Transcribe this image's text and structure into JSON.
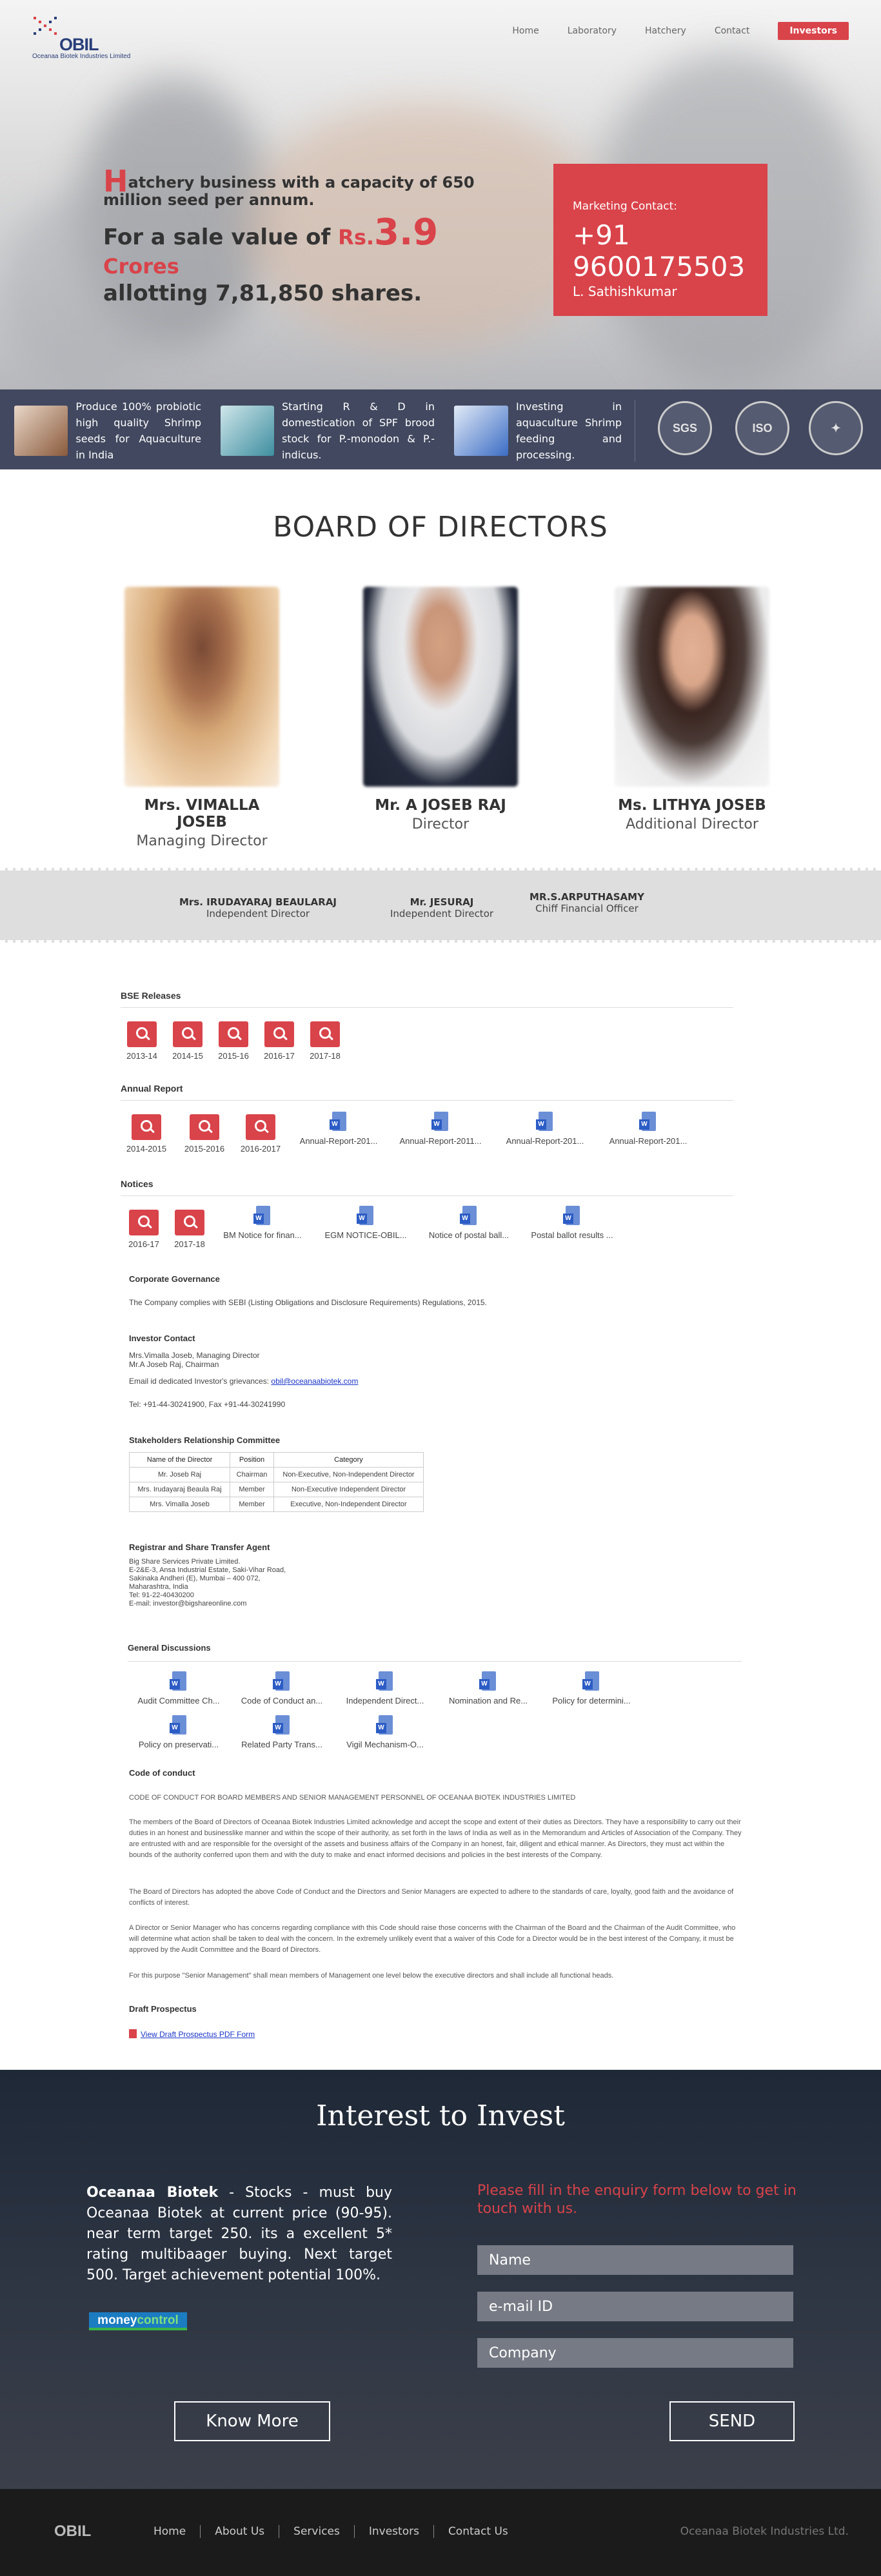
{
  "header": {
    "logo_word": "OBIL",
    "logo_sub": "Oceanaa Biotek Industries Limited",
    "nav": [
      "Home",
      "Laboratory",
      "Hatchery",
      "Contact",
      "Investors"
    ]
  },
  "hero": {
    "cap_letter": "H",
    "line1_rest": "atchery business with a capacity of 650 million seed per annum.",
    "line2_pre": "For a sale value of ",
    "line2_rs": "Rs.",
    "line2_big": "3.9",
    "line2_unit": " Crores",
    "line3": "allotting 7,81,850 shares.",
    "marketing_label": "Marketing Contact:",
    "marketing_phone": "+91 9600175503",
    "marketing_name": "L. Sathishkumar"
  },
  "features": [
    {
      "text": "Produce 100% probiotic high quality Shrimp seeds for Aquaculture in India"
    },
    {
      "text": "Starting R & D in domestication of SPF brood stock for P.-monodon & P.-indicus."
    },
    {
      "text": "Investing in aquaculture Shrimp feeding and processing."
    }
  ],
  "badges": [
    "SGS",
    "ISO",
    "✦"
  ],
  "board": {
    "title": "BOARD OF DIRECTORS",
    "directors": [
      {
        "name": "Mrs. VIMALLA JOSEB",
        "role": "Managing Director"
      },
      {
        "name": "Mr. A JOSEB RAJ",
        "role": "Director"
      },
      {
        "name": "Ms. LITHYA JOSEB",
        "role": "Additional Director"
      }
    ],
    "independent": [
      {
        "name": "Mrs. IRUDAYARAJ BEAULARAJ",
        "role": "Independent Director"
      },
      {
        "name": "Mr. JESURAJ",
        "role": "Independent Director"
      },
      {
        "name": "MR.S.ARPUTHASAMY",
        "role": "Chiff Financial Officer"
      }
    ]
  },
  "bse": {
    "heading": "BSE Releases",
    "items": [
      "2013-14",
      "2014-15",
      "2015-16",
      "2016-17",
      "2017-18"
    ]
  },
  "annual": {
    "heading": "Annual Report",
    "mag_items": [
      "2014-2015",
      "2015-2016",
      "2016-2017"
    ],
    "doc_items": [
      "Annual-Report-201...",
      "Annual-Report-2011...",
      "Annual-Report-201...",
      "Annual-Report-201..."
    ]
  },
  "notices": {
    "heading": "Notices",
    "mag_items": [
      "2016-17",
      "2017-18"
    ],
    "doc_items": [
      "BM Notice for finan...",
      "EGM NOTICE-OBIL...",
      "Notice of postal ball...",
      "Postal ballot results ..."
    ]
  },
  "governance": {
    "heading": "Corporate Governance",
    "text": "The Company complies with SEBI (Listing Obligations and Disclosure Requirements) Regulations, 2015."
  },
  "investor_contact": {
    "heading": "Investor Contact",
    "line1": "Mrs.Vimalla Joseb, Managing Director",
    "line2": "Mr.A Joseb Raj, Chairman",
    "email_label": "Email id dedicated Investor's grievances: ",
    "email": "obil@oceanaabiotek.com",
    "tel": "Tel: +91-44-30241900, Fax +91-44-30241990"
  },
  "src": {
    "heading": "Stakeholders Relationship Committee",
    "columns": [
      "Name of the Director",
      "Position",
      "Category"
    ],
    "rows": [
      [
        "Mr. Joseb Raj",
        "Chairman",
        "Non-Executive, Non-Independent Director"
      ],
      [
        "Mrs. Irudayaraj Beaula Raj",
        "Member",
        "Non-Executive Independent Director"
      ],
      [
        "Mrs. Vimalla Joseb",
        "Member",
        "Executive, Non-Independent Director"
      ]
    ]
  },
  "registrar": {
    "heading": "Registrar and Share Transfer Agent",
    "lines": [
      "Big Share Services Private Limited.",
      "E-2&E-3, Ansa Industrial Estate, Saki-Vihar Road,",
      "Sakinaka Andheri (E), Mumbai – 400 072,",
      "Maharashtra, India",
      "Tel: 91-22-40430200",
      "E-mail: investor@bigshareonline.com"
    ]
  },
  "general": {
    "heading": "General Discussions",
    "row1": [
      "Audit Committee Ch...",
      "Code of Conduct an...",
      "Independent Direct...",
      "Nomination and Re...",
      "Policy for determini..."
    ],
    "row2": [
      "Policy on preservati...",
      "Related Party Trans...",
      "Vigil Mechanism-O..."
    ]
  },
  "code": {
    "heading": "Code of conduct",
    "title": "CODE OF CONDUCT FOR BOARD MEMBERS AND SENIOR MANAGEMENT PERSONNEL OF OCEANAA BIOTEK INDUSTRIES LIMITED",
    "p1": "The members of the Board of Directors of Oceanaa Biotek Industries Limited acknowledge and accept the scope and extent of their duties as Directors. They have a responsibility to carry out their duties in an honest and businesslike manner and within the scope of their authority, as set forth in the laws of India as well as in the Memorandum and Articles of Association of the Company. They are entrusted with and are responsible for the oversight of the assets and business affairs of the Company in an honest, fair, diligent and ethical manner. As Directors, they must act within the bounds of the authority conferred upon them and with the duty to make and enact informed decisions and policies in the best interests of the Company.",
    "p2": "The Board of Directors has adopted the above Code of Conduct and the Directors and Senior Managers are expected to adhere to the standards of care, loyalty, good faith and the avoidance of conflicts of interest.",
    "p3": "A Director or Senior Manager who has concerns regarding compliance with this Code should raise those concerns with the Chairman of the Board and the Chairman of the Audit Committee, who will determine what action shall be taken to deal with the concern. In the extremely unlikely event that a waiver of this Code for a Director would be in the best interest of the Company, it must be approved by the Audit Committee and the Board of Directors.",
    "p4": "For this purpose \"Senior Management\" shall mean members of Management one level below the executive directors and shall include all functional heads."
  },
  "draft": {
    "heading": "Draft Prospectus",
    "link": "View Draft Prospectus PDF Form"
  },
  "invest": {
    "title": "Interest to Invest",
    "brand": "Oceanaa Biotek",
    "text": " - Stocks - must buy Oceanaa Biotek at current price (90-95). near term target 250. its a excellent 5* rating multibaager buying. Next target 500. Target achievement potential 100%.",
    "mc_a": "money",
    "mc_b": "control",
    "form_heading": "Please fill in the enquiry form below to get in touch with us.",
    "name_placeholder": "Name",
    "email_placeholder": "e-mail ID",
    "company_placeholder": "Company",
    "know_more": "Know More",
    "send": "SEND"
  },
  "footer": {
    "logo": "OBIL",
    "nav": [
      "Home",
      "About Us",
      "Services",
      "Investors",
      "Contact Us"
    ],
    "copyright": "Oceanaa Biotek Industries Ltd."
  }
}
